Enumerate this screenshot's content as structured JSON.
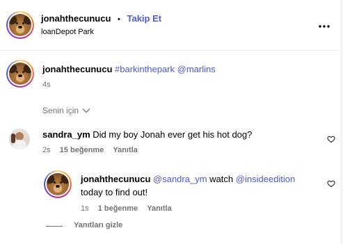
{
  "header": {
    "username": "jonahthecunucu",
    "separator": "•",
    "follow_label": "Takip Et",
    "location": "loanDepot Park",
    "more_icon": "more-horizontal-icon"
  },
  "caption": {
    "username": "jonahthecunucu",
    "hashtag": "#barkinthepark",
    "mention": "@marlins",
    "time": "4s"
  },
  "sort": {
    "label": "Senin için",
    "icon": "chevron-down-icon"
  },
  "comments": [
    {
      "username": "sandra_ym",
      "text": "Did my boy Jonah ever get his hot dog?",
      "time": "2s",
      "likes": "15 beğenme",
      "reply_label": "Yanıtla"
    }
  ],
  "reply": {
    "username": "jonahthecunucu",
    "mention1": "@sandra_ym",
    "middle_text": "watch",
    "mention2": "@insideedition",
    "line2": "today to find out!",
    "time": "1s",
    "likes": "1 beğenme",
    "reply_label": "Yanıtla"
  },
  "hide_replies_label": "Yanıtları gizle",
  "colors": {
    "link": "#4a5ad8",
    "meta": "#737373"
  }
}
